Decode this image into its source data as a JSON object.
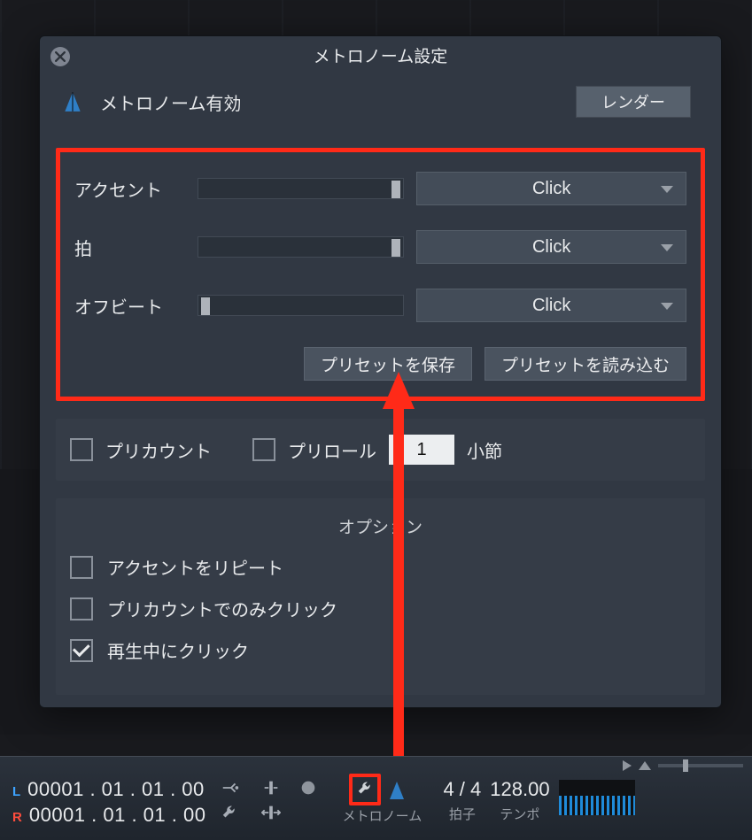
{
  "dialog": {
    "title": "メトロノーム設定",
    "enable_label": "メトロノーム有効",
    "render_label": "レンダー",
    "rows": [
      {
        "label": "アクセント",
        "dropdown": "Click",
        "thumb": "right"
      },
      {
        "label": "拍",
        "dropdown": "Click",
        "thumb": "right"
      },
      {
        "label": "オフビート",
        "dropdown": "Click",
        "thumb": "left"
      }
    ],
    "save_preset": "プリセットを保存",
    "load_preset": "プリセットを読み込む",
    "precount_label": "プリカウント",
    "preroll_label": "プリロール",
    "preroll_value": "1",
    "bars_label": "小節",
    "options_heading": "オプション",
    "opt_repeat_accent": "アクセントをリピート",
    "opt_click_precount_only": "プリカウントでのみクリック",
    "opt_click_during_play": "再生中にクリック"
  },
  "transport": {
    "L": "L",
    "R": "R",
    "tc_l": "00001 . 01 . 01 . 00",
    "tc_r": "00001 . 01 . 01 . 00",
    "metronome_label": "メトロノーム",
    "timesig_value": "4 / 4",
    "timesig_label": "拍子",
    "tempo_value": "128.00",
    "tempo_label": "テンポ"
  }
}
